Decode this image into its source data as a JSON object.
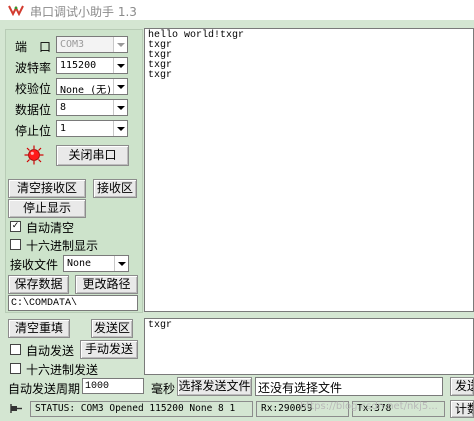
{
  "window": {
    "title": "串口调试小助手 1.3"
  },
  "settings": {
    "port_label": "端　口",
    "port_value": "COM3",
    "baud_label": "波特率",
    "baud_value": "115200",
    "parity_label": "校验位",
    "parity_value": "None (无)",
    "databits_label": "数据位",
    "databits_value": "8",
    "stopbits_label": "停止位",
    "stopbits_value": "1",
    "close_port_label": "关闭串口"
  },
  "receive": {
    "clear_label": "清空接收区",
    "area_label": "接收区",
    "stop_display_label": "停止显示",
    "auto_clear_label": "自动清空",
    "auto_clear_checked": true,
    "hex_display_label": "十六进制显示",
    "hex_display_checked": false,
    "file_label": "接收文件",
    "file_value": "None",
    "save_data_label": "保存数据",
    "change_path_label": "更改路径",
    "path_value": "C:\\COMDATA\\",
    "content": "hello world!txgr\ntxgr\ntxgr\ntxgr\ntxgr"
  },
  "send": {
    "clear_label": "清空重填",
    "area_label": "发送区",
    "auto_send_label": "自动发送",
    "manual_send_label": "手动发送",
    "hex_send_label": "十六进制发送",
    "period_label": "自动发送周期",
    "period_value": "1000",
    "ms_label": "毫秒",
    "select_file_label": "选择发送文件",
    "file_status": "还没有选择文件",
    "send_file_label": "发送",
    "content": "txgr"
  },
  "status": {
    "text": "STATUS: COM3 Opened 115200 None  8 1",
    "rx": "Rx:290059",
    "tx": "Tx:378",
    "count_label": "计数"
  },
  "watermark": "https://blog.csdn.net/nkj5..."
}
